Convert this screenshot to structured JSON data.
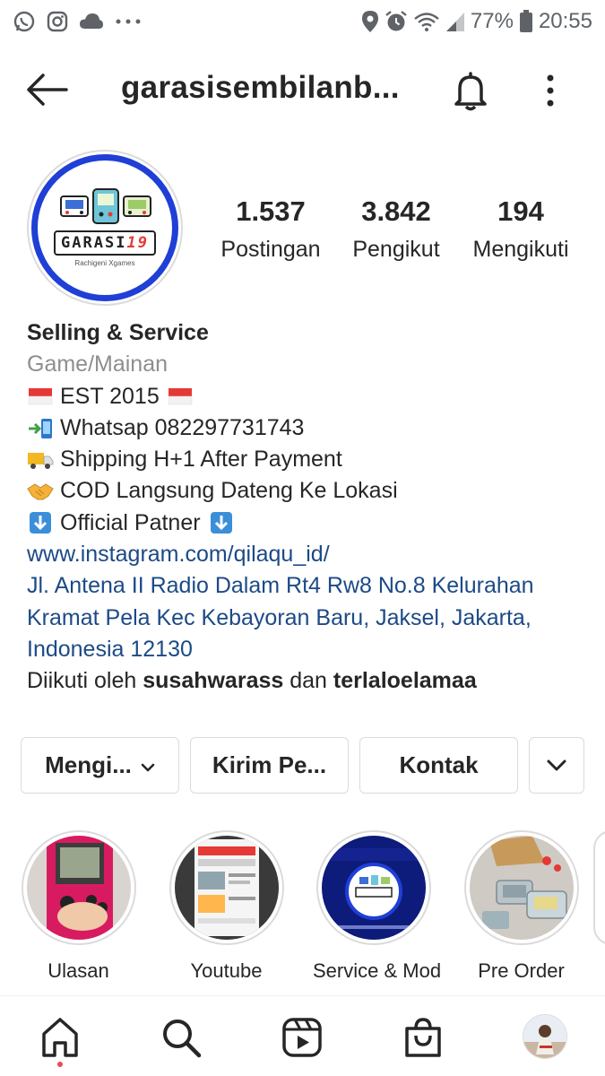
{
  "status_bar": {
    "battery": "77%",
    "time": "20:55",
    "left_icons": [
      "whatsapp-icon",
      "instagram-icon",
      "cloud-icon",
      "more-dots-icon"
    ],
    "right_icons": [
      "location-icon",
      "alarm-icon",
      "wifi-icon",
      "signal-icon",
      "battery-icon"
    ]
  },
  "header": {
    "username": "garasisembilanb..."
  },
  "profile": {
    "stats": {
      "posts_value": "1.537",
      "posts_label": "Postingan",
      "followers_value": "3.842",
      "followers_label": "Pengikut",
      "following_value": "194",
      "following_label": "Mengikuti"
    },
    "avatar_logo_text": "GARASI",
    "avatar_logo_number": "19",
    "avatar_logo_subtext": "Rachigeni Xgames"
  },
  "bio": {
    "name": "Selling & Service",
    "category": "Game/Mainan",
    "lines": [
      "EST 2015",
      "Whatsap 082297731743",
      "Shipping H+1 After Payment",
      "COD Langsung Dateng Ke Lokasi",
      "Official Patner"
    ],
    "link": "www.instagram.com/qilaqu_id/",
    "address_lines": [
      "Jl. Antena II Radio Dalam Rt4 Rw8 No.8 Kelurahan",
      "Kramat Pela Kec Kebayoran Baru, Jaksel, Jakarta,",
      "Indonesia 12130"
    ],
    "followed_by_prefix": "Diikuti oleh",
    "followed_by_user1": "susahwarass",
    "followed_by_connector": "dan",
    "followed_by_user2": "terlaloelamaa"
  },
  "actions": {
    "following_label": "Mengi...",
    "message_label": "Kirim Pe...",
    "contact_label": "Kontak"
  },
  "highlights": [
    {
      "label": "Ulasan"
    },
    {
      "label": "Youtube"
    },
    {
      "label": "Service & Mod"
    },
    {
      "label": "Pre Order"
    }
  ],
  "colors": {
    "link": "#1c4a86",
    "avatar_ring": "#1f3fd6",
    "notification_dot": "#ed4956",
    "secondary_text": "#8e8e8e"
  }
}
